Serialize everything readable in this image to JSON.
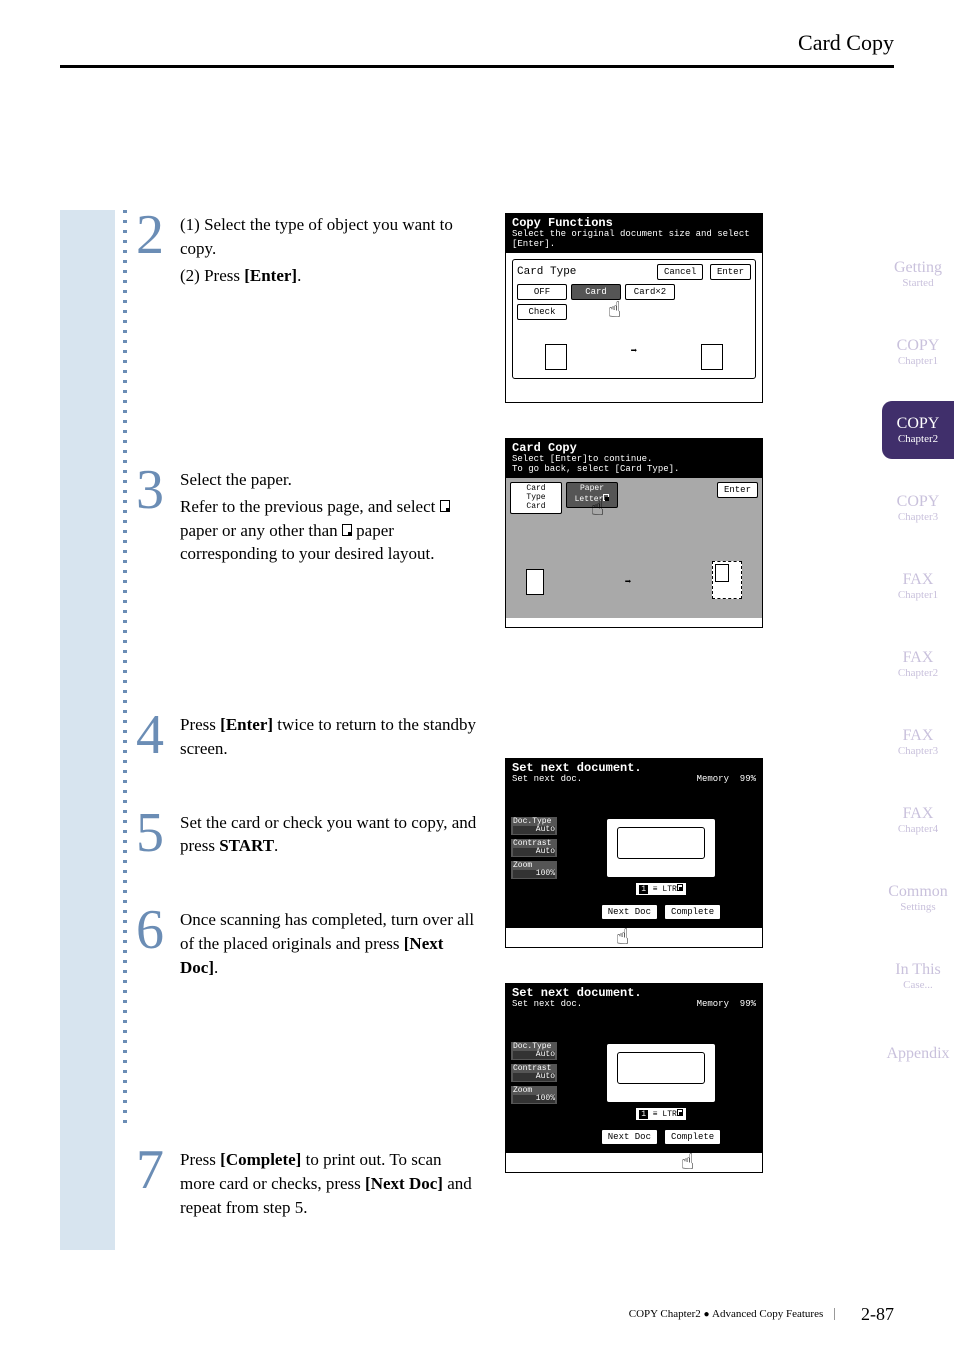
{
  "header": {
    "title": "Card Copy"
  },
  "steps": [
    {
      "num": "2",
      "lines": [
        "(1) Select the type of object you want to copy.",
        "(2) Press [Enter]."
      ],
      "bold_terms": {
        "enter": "[Enter]"
      }
    },
    {
      "num": "3",
      "lines": [
        "Select the paper.",
        "Refer to the previous page, and select ▯ paper or any other than ▯ paper corresponding to your desired layout."
      ]
    },
    {
      "num": "4",
      "lines": [
        "Press [Enter] twice to return to the standby screen."
      ]
    },
    {
      "num": "5",
      "lines": [
        "Set the card or check you want to copy, and press START."
      ]
    },
    {
      "num": "6",
      "lines": [
        "Once scanning has completed, turn over all of the placed originals and press [Next Doc]."
      ]
    },
    {
      "num": "7",
      "lines": [
        "Press [Complete] to print out. To scan more card or checks, press [Next Doc] and repeat from step 5."
      ]
    }
  ],
  "screens": {
    "copy_functions": {
      "title": "Copy Functions",
      "subtitle": "Select the original document size and select [Enter].",
      "field_label": "Card Type",
      "cancel": "Cancel",
      "enter": "Enter",
      "options": [
        "OFF",
        "Card",
        "Card×2",
        "Check"
      ]
    },
    "card_copy": {
      "title": "Card Copy",
      "subtitle1": "Select [Enter]to continue.",
      "subtitle2": "To go back, select [Card Type].",
      "card_type_label": "Card Type",
      "card_type_value": "Card",
      "paper_label": "Paper",
      "paper_value": "Letter",
      "enter": "Enter"
    },
    "set_next_1": {
      "title": "Set next document.",
      "subtitle": "Set next doc.",
      "memory_label": "Memory",
      "memory_value": "99%",
      "doc_type_label": "Doc.Type",
      "doc_type_value": "Auto",
      "contrast_label": "Contrast",
      "contrast_value": "Auto",
      "zoom_label": "Zoom",
      "zoom_value": "100%",
      "tray": "LTR",
      "tray_num": "1",
      "next_doc": "Next Doc",
      "complete": "Complete"
    },
    "set_next_2": {
      "title": "Set next document.",
      "subtitle": "Set next doc.",
      "memory_label": "Memory",
      "memory_value": "99%",
      "doc_type_label": "Doc.Type",
      "doc_type_value": "Auto",
      "contrast_label": "Contrast",
      "contrast_value": "Auto",
      "zoom_label": "Zoom",
      "zoom_value": "100%",
      "tray": "LTR",
      "tray_num": "1",
      "next_doc": "Next Doc",
      "complete": "Complete"
    }
  },
  "tabs": [
    {
      "t1": "Getting",
      "t2": "Started"
    },
    {
      "t1": "COPY",
      "t2": "Chapter1"
    },
    {
      "t1": "COPY",
      "t2": "Chapter2",
      "active": true
    },
    {
      "t1": "COPY",
      "t2": "Chapter3"
    },
    {
      "t1": "FAX",
      "t2": "Chapter1"
    },
    {
      "t1": "FAX",
      "t2": "Chapter2"
    },
    {
      "t1": "FAX",
      "t2": "Chapter3"
    },
    {
      "t1": "FAX",
      "t2": "Chapter4"
    },
    {
      "t1": "Common",
      "t2": "Settings"
    },
    {
      "t1": "In This",
      "t2": "Case..."
    },
    {
      "t1": "Appendix",
      "t2": ""
    }
  ],
  "footer": {
    "crumb": "COPY Chapter2",
    "section": "Advanced Copy Features",
    "page": "2-87"
  }
}
